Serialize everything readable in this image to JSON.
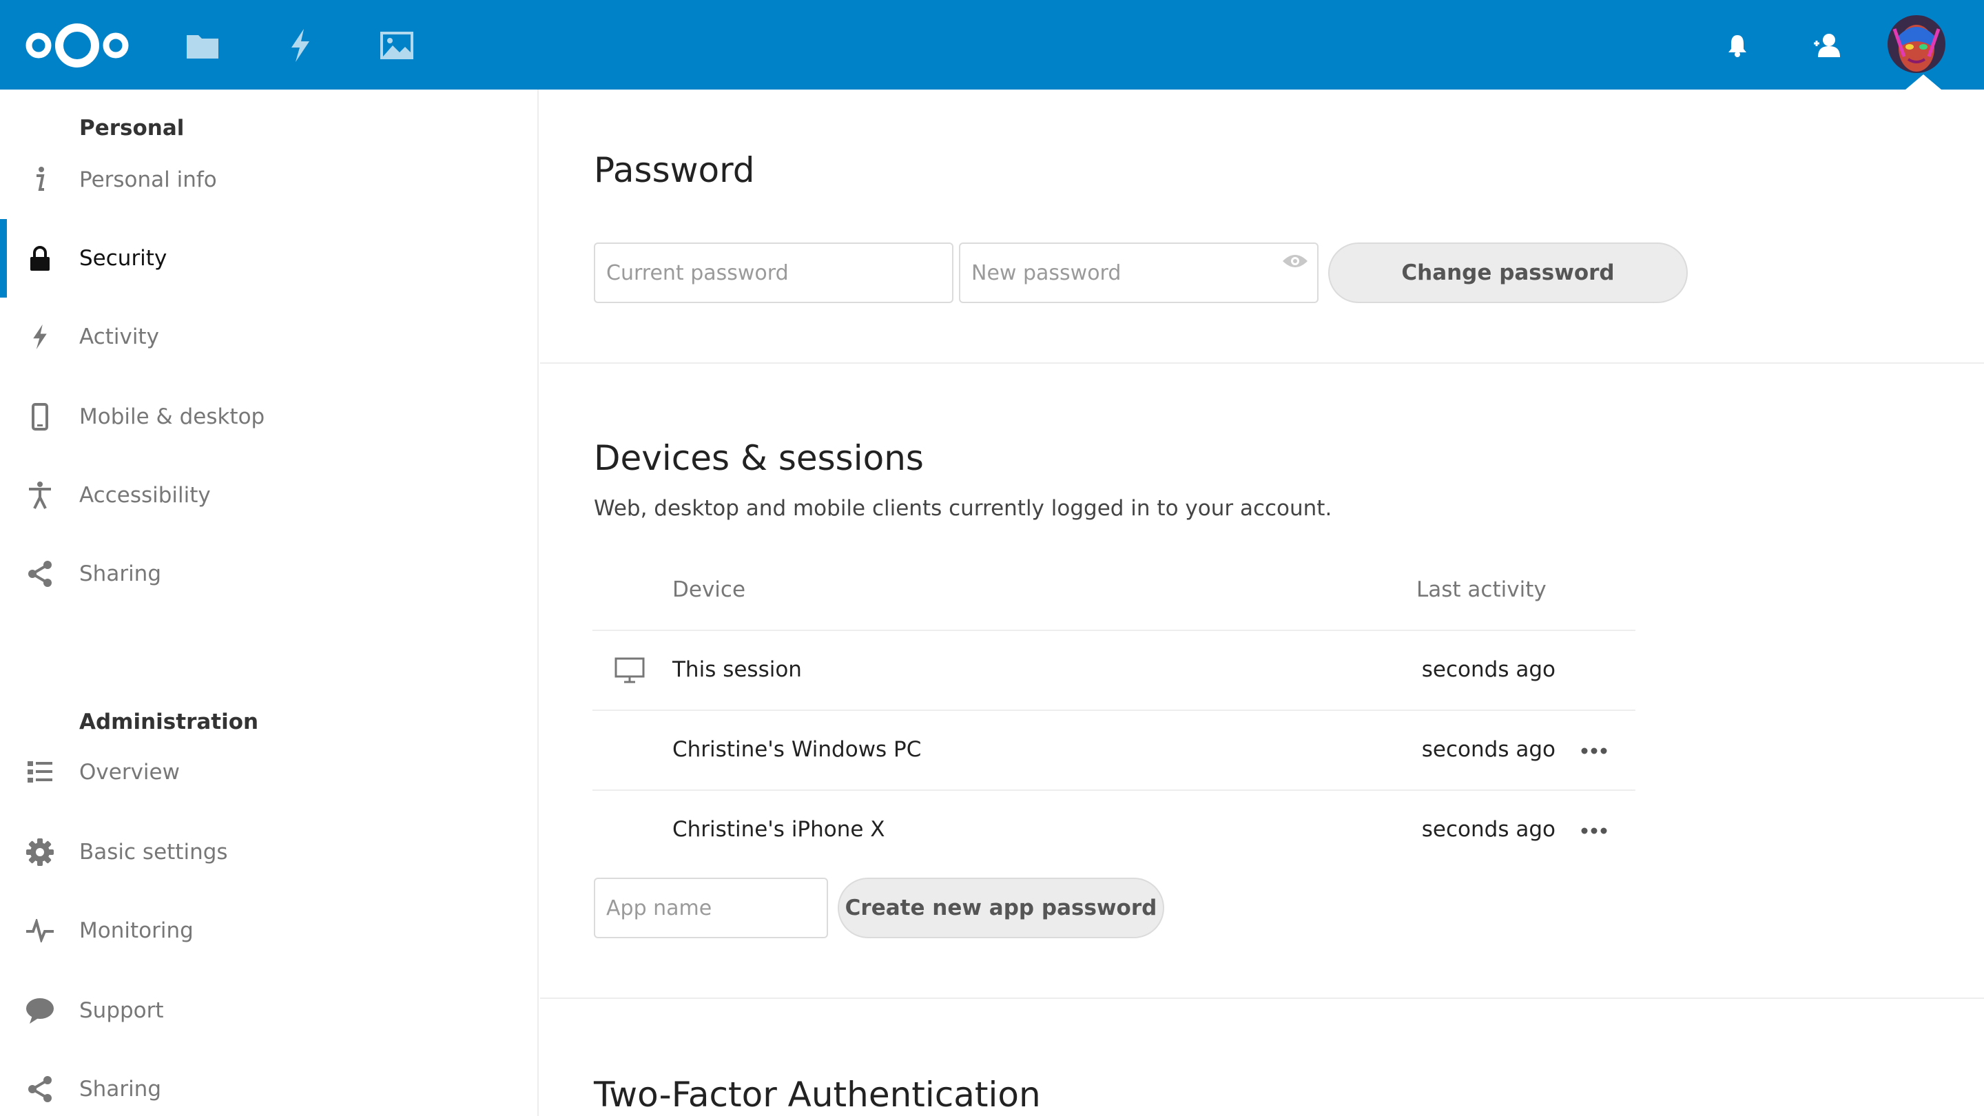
{
  "colors": {
    "brand": "#0082c9",
    "active_indicator": "#0082c9",
    "divider": "#ededed"
  },
  "header": {
    "apps": [
      {
        "name": "files",
        "icon": "folder-icon"
      },
      {
        "name": "activity",
        "icon": "lightning-icon"
      },
      {
        "name": "gallery",
        "icon": "image-icon"
      }
    ],
    "right_icons": [
      "bell-icon",
      "contacts-icon"
    ],
    "logo_icon": "nextcloud-logo"
  },
  "sidebar": {
    "personal_caption": "Personal",
    "personal_items": [
      {
        "label": "Personal info",
        "icon": "info-icon"
      },
      {
        "label": "Security",
        "icon": "lock-icon",
        "active": true
      },
      {
        "label": "Activity",
        "icon": "lightning-icon"
      },
      {
        "label": "Mobile & desktop",
        "icon": "phone-icon"
      },
      {
        "label": "Accessibility",
        "icon": "accessibility-icon"
      },
      {
        "label": "Sharing",
        "icon": "share-icon"
      }
    ],
    "admin_caption": "Administration",
    "admin_items": [
      {
        "label": "Overview",
        "icon": "list-icon"
      },
      {
        "label": "Basic settings",
        "icon": "gear-icon"
      },
      {
        "label": "Monitoring",
        "icon": "pulse-icon"
      },
      {
        "label": "Support",
        "icon": "speech-bubble-icon"
      },
      {
        "label": "Sharing",
        "icon": "share-icon"
      }
    ]
  },
  "password": {
    "title": "Password",
    "current_placeholder": "Current password",
    "new_placeholder": "New password",
    "button": "Change password"
  },
  "devices": {
    "title": "Devices & sessions",
    "description": "Web, desktop and mobile clients currently logged in to your account.",
    "col_device": "Device",
    "col_activity": "Last activity",
    "rows": [
      {
        "name": "This session",
        "time": "seconds ago",
        "icon": "monitor-icon"
      },
      {
        "name": "Christine's Windows PC",
        "time": "seconds ago",
        "icon": "more-icon"
      },
      {
        "name": "Christine's iPhone X",
        "time": "seconds ago",
        "icon": "more-icon"
      }
    ],
    "app_name_placeholder": "App name",
    "create_button": "Create new app password"
  },
  "two_factor": {
    "title": "Two-Factor Authentication"
  }
}
